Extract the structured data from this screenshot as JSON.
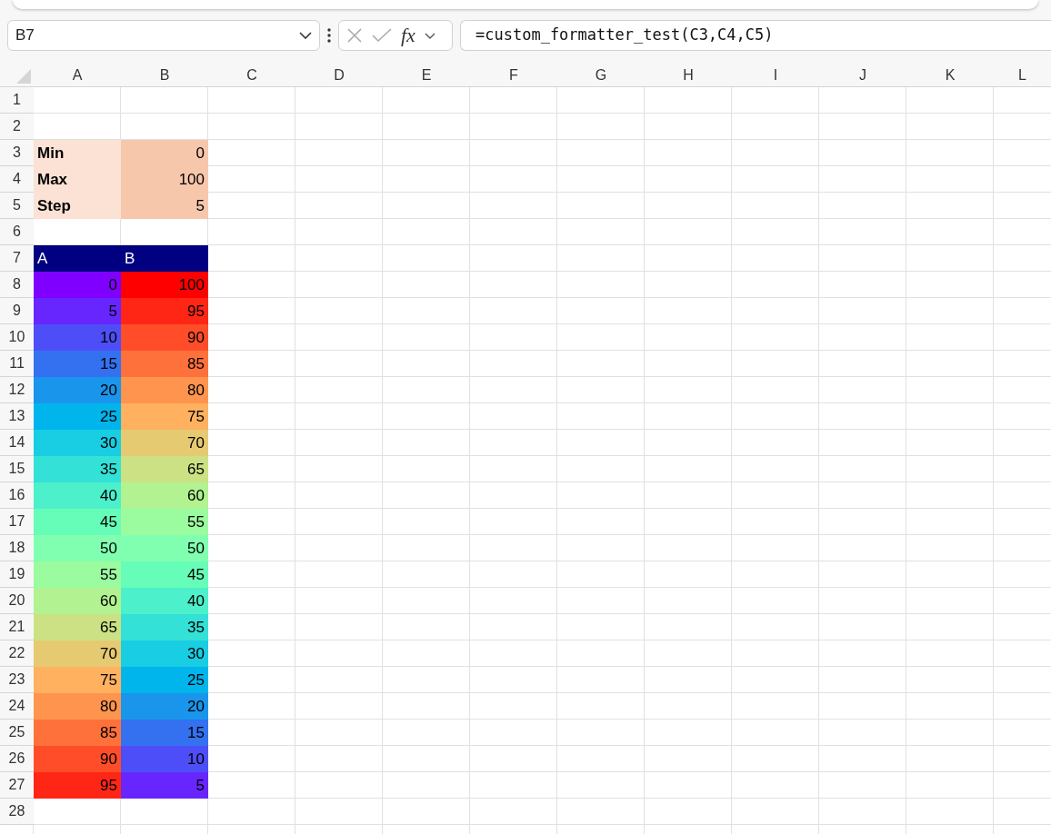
{
  "formula_bar": {
    "name_box": "B7",
    "function_label": "fx",
    "formula": "=custom_formatter_test(C3,C4,C5)"
  },
  "sheet": {
    "columns": [
      "A",
      "B",
      "C",
      "D",
      "E",
      "F",
      "G",
      "H",
      "I",
      "J",
      "K",
      "L"
    ],
    "row_numbers": [
      "1",
      "2",
      "3",
      "4",
      "5",
      "6",
      "7",
      "8",
      "9",
      "10",
      "11",
      "12",
      "13",
      "14",
      "15",
      "16",
      "17",
      "18",
      "19",
      "20",
      "21",
      "22",
      "23",
      "24",
      "25",
      "26",
      "27",
      "28"
    ],
    "parameters": [
      {
        "label": "Min",
        "value": "0"
      },
      {
        "label": "Max",
        "value": "100"
      },
      {
        "label": "Step",
        "value": "5"
      }
    ],
    "color_table": {
      "headers": [
        "A",
        "B"
      ],
      "rows": [
        [
          {
            "text": "0",
            "color": "#7f00ff"
          },
          {
            "text": "100",
            "color": "#ff0000"
          }
        ],
        [
          {
            "text": "5",
            "color": "#6826fe"
          },
          {
            "text": "95",
            "color": "#ff2616"
          }
        ],
        [
          {
            "text": "10",
            "color": "#4e4ef8"
          },
          {
            "text": "90",
            "color": "#ff4d2a"
          }
        ],
        [
          {
            "text": "15",
            "color": "#3371f0"
          },
          {
            "text": "85",
            "color": "#ff713b"
          }
        ],
        [
          {
            "text": "20",
            "color": "#1a95ec"
          },
          {
            "text": "80",
            "color": "#ff944e"
          }
        ],
        [
          {
            "text": "25",
            "color": "#00b5eb"
          },
          {
            "text": "75",
            "color": "#ffb160"
          }
        ],
        [
          {
            "text": "30",
            "color": "#19cde3"
          },
          {
            "text": "70",
            "color": "#e5ca72"
          }
        ],
        [
          {
            "text": "35",
            "color": "#33e1d6"
          },
          {
            "text": "65",
            "color": "#cce183"
          }
        ],
        [
          {
            "text": "40",
            "color": "#4cf0cb"
          },
          {
            "text": "60",
            "color": "#b2f290"
          }
        ],
        [
          {
            "text": "45",
            "color": "#66fdb8"
          },
          {
            "text": "55",
            "color": "#9afb9f"
          }
        ],
        [
          {
            "text": "50",
            "color": "#81ffb0"
          },
          {
            "text": "50",
            "color": "#81ffb0"
          }
        ],
        [
          {
            "text": "55",
            "color": "#9afb9f"
          },
          {
            "text": "45",
            "color": "#66fdb8"
          }
        ],
        [
          {
            "text": "60",
            "color": "#b2f290"
          },
          {
            "text": "40",
            "color": "#4cf0cb"
          }
        ],
        [
          {
            "text": "65",
            "color": "#cce183"
          },
          {
            "text": "35",
            "color": "#33e1d6"
          }
        ],
        [
          {
            "text": "70",
            "color": "#e5ca72"
          },
          {
            "text": "30",
            "color": "#19cde3"
          }
        ],
        [
          {
            "text": "75",
            "color": "#ffb160"
          },
          {
            "text": "25",
            "color": "#00b5eb"
          }
        ],
        [
          {
            "text": "80",
            "color": "#ff944e"
          },
          {
            "text": "20",
            "color": "#1a95ec"
          }
        ],
        [
          {
            "text": "85",
            "color": "#ff713b"
          },
          {
            "text": "15",
            "color": "#3371f0"
          }
        ],
        [
          {
            "text": "90",
            "color": "#ff4d2a"
          },
          {
            "text": "10",
            "color": "#4e4ef8"
          }
        ],
        [
          {
            "text": "95",
            "color": "#ff2616"
          },
          {
            "text": "5",
            "color": "#6826fe"
          }
        ]
      ]
    }
  }
}
